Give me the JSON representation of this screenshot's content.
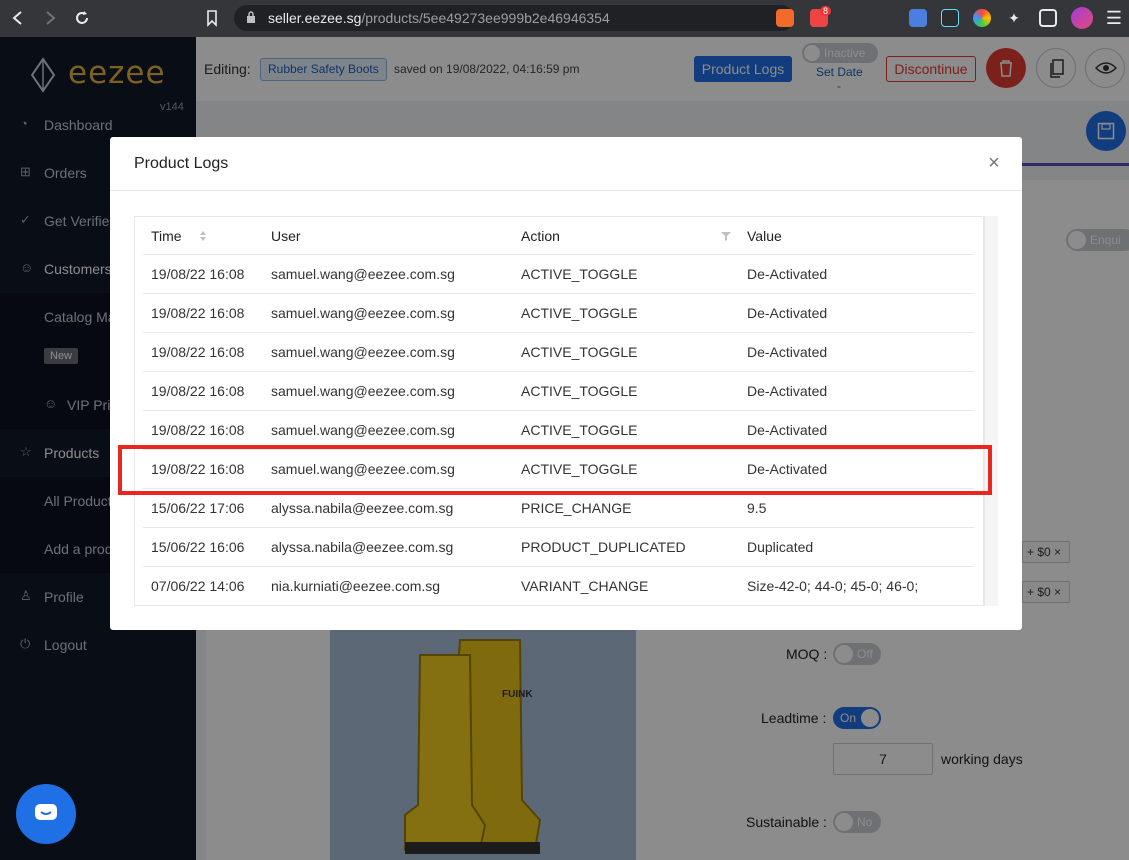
{
  "browser": {
    "url_host": "seller.eezee.sg",
    "url_path": "/products/5ee49273ee999b2e46946354",
    "brave_badge": "8"
  },
  "sidebar": {
    "logo": "eezee",
    "version": "v144",
    "items": [
      {
        "label": "Dashboard",
        "icon": "dashboard-icon"
      },
      {
        "label": "Orders",
        "icon": "cart-icon"
      },
      {
        "label": "Get Verified",
        "icon": "check-icon"
      },
      {
        "label": "Customers",
        "icon": "smile-icon"
      },
      {
        "label": "Catalog Ma",
        "icon": ""
      },
      {
        "label": "VIP Pri",
        "icon": "smile-icon"
      },
      {
        "label": "Products",
        "icon": "star-icon"
      },
      {
        "label": "All Product",
        "icon": ""
      },
      {
        "label": "Add a produ",
        "icon": ""
      },
      {
        "label": "Profile",
        "icon": "user-icon"
      },
      {
        "label": "Logout",
        "icon": "logout-icon"
      }
    ],
    "new_badge": "New"
  },
  "header": {
    "editing_label": "Editing:",
    "product_tag": "Rubber Safety Boots",
    "saved_text": "saved on 19/08/2022, 04:16:59 pm",
    "product_logs_button": "Product Logs",
    "active_toggle_label": "Inactive",
    "set_date_link": "Set Date",
    "set_date_value": "-",
    "discontinue_button": "Discontinue"
  },
  "background_form": {
    "enquiry_toggle": "Enqui",
    "chips": [
      "+ $0",
      "+ $0"
    ],
    "moq_label": "MOQ :",
    "moq_toggle": "Off",
    "leadtime_label": "Leadtime :",
    "leadtime_toggle": "On",
    "leadtime_value": "7",
    "leadtime_unit": "working days",
    "sustainable_label": "Sustainable :",
    "sustainable_toggle": "No",
    "boot_brand": "FUINK"
  },
  "modal": {
    "title": "Product Logs",
    "columns": [
      "Time",
      "User",
      "Action",
      "Value"
    ],
    "rows": [
      {
        "time": "19/08/22 16:08",
        "user": "samuel.wang@eezee.com.sg",
        "action": "ACTIVE_TOGGLE",
        "value": "De-Activated"
      },
      {
        "time": "19/08/22 16:08",
        "user": "samuel.wang@eezee.com.sg",
        "action": "ACTIVE_TOGGLE",
        "value": "De-Activated"
      },
      {
        "time": "19/08/22 16:08",
        "user": "samuel.wang@eezee.com.sg",
        "action": "ACTIVE_TOGGLE",
        "value": "De-Activated"
      },
      {
        "time": "19/08/22 16:08",
        "user": "samuel.wang@eezee.com.sg",
        "action": "ACTIVE_TOGGLE",
        "value": "De-Activated"
      },
      {
        "time": "19/08/22 16:08",
        "user": "samuel.wang@eezee.com.sg",
        "action": "ACTIVE_TOGGLE",
        "value": "De-Activated"
      },
      {
        "time": "19/08/22 16:08",
        "user": "samuel.wang@eezee.com.sg",
        "action": "ACTIVE_TOGGLE",
        "value": "De-Activated"
      },
      {
        "time": "15/06/22 17:06",
        "user": "alyssa.nabila@eezee.com.sg",
        "action": "PRICE_CHANGE",
        "value": "9.5"
      },
      {
        "time": "15/06/22 16:06",
        "user": "alyssa.nabila@eezee.com.sg",
        "action": "PRODUCT_DUPLICATED",
        "value": "Duplicated"
      },
      {
        "time": "07/06/22 14:06",
        "user": "nia.kurniati@eezee.com.sg",
        "action": "VARIANT_CHANGE",
        "value": "Size-42-0; 44-0; 45-0; 46-0;"
      }
    ]
  },
  "colors": {
    "brand_blue": "#1f6fe5",
    "sidebar_bg": "#101828",
    "logo_gold": "#e0b23c",
    "danger_red": "#e03b32",
    "highlight_red": "#e8281e"
  }
}
